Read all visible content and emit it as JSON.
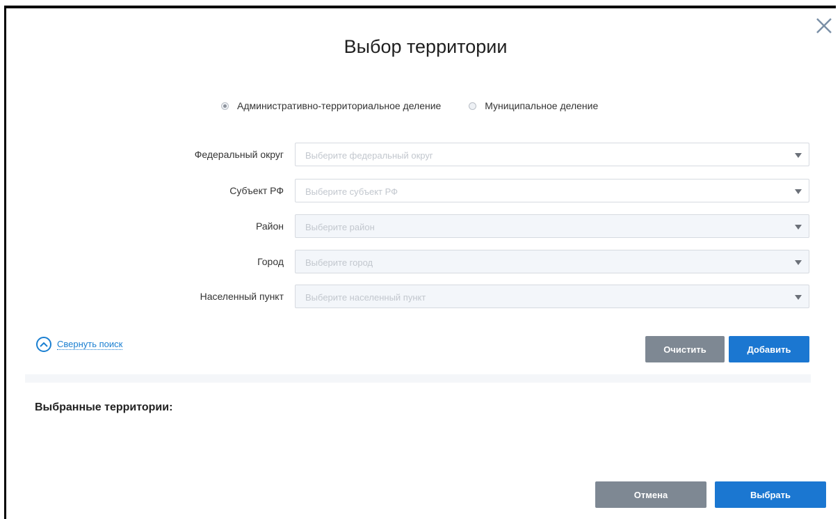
{
  "dialog": {
    "title": "Выбор территории",
    "close_icon": "close-icon"
  },
  "division_type": {
    "options": [
      {
        "label": "Административно-территориальное деление",
        "selected": true
      },
      {
        "label": "Муниципальное деление",
        "selected": false
      }
    ]
  },
  "fields": [
    {
      "label": "Федеральный округ",
      "placeholder": "Выберите федеральный округ",
      "disabled": false
    },
    {
      "label": "Субъект РФ",
      "placeholder": "Выберите субъект РФ",
      "disabled": false
    },
    {
      "label": "Район",
      "placeholder": "Выберите район",
      "disabled": true
    },
    {
      "label": "Город",
      "placeholder": "Выберите город",
      "disabled": true
    },
    {
      "label": "Населенный пункт",
      "placeholder": "Выберите населенный пункт",
      "disabled": true
    }
  ],
  "search": {
    "collapse_label": "Свернуть поиск",
    "collapse_icon": "chevron-up-circle-icon",
    "clear_label": "Очистить",
    "add_label": "Добавить"
  },
  "selected": {
    "title": "Выбранные территории:"
  },
  "footer": {
    "cancel_label": "Отмена",
    "select_label": "Выбрать"
  },
  "colors": {
    "accent": "#1b77d1",
    "secondary_button": "#7e8893"
  }
}
